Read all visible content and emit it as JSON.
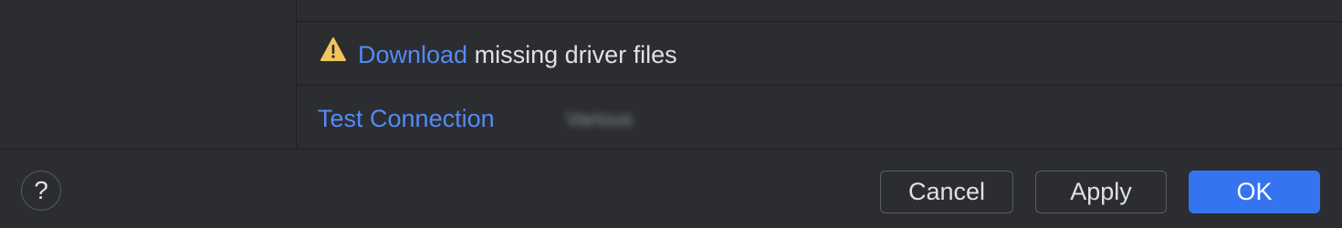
{
  "warning": {
    "icon": "warning-icon",
    "link_label": "Download",
    "message": " missing driver files",
    "icon_color": "#f2c55c"
  },
  "connection": {
    "test_label": "Test Connection",
    "status": "Various"
  },
  "footer": {
    "help_label": "?",
    "cancel_label": "Cancel",
    "apply_label": "Apply",
    "ok_label": "OK"
  },
  "colors": {
    "background": "#2b2d30",
    "link": "#548af7",
    "primary_button": "#3574f0",
    "text": "#dfe1e5"
  }
}
